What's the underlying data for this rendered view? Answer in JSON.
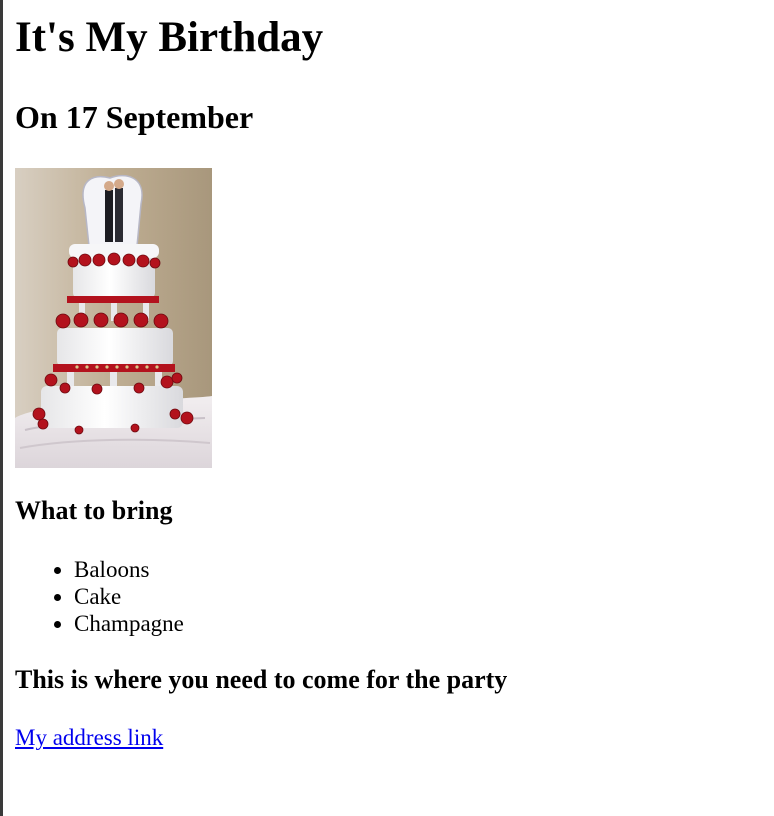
{
  "header": {
    "title": "It's My Birthday",
    "date": "On 17 September"
  },
  "photo": {
    "icon": "birthday-cake-photo",
    "alt": ""
  },
  "bring": {
    "heading": "What to bring",
    "items": [
      "Baloons",
      "Cake",
      "Champagne"
    ]
  },
  "location": {
    "heading": "This is where you need to come for the party",
    "link_text": "My address link"
  },
  "colors": {
    "link": "#0000ee",
    "frame_line": "#3a3a3a",
    "cake_red": "#b3121d",
    "background": "#ffffff"
  }
}
